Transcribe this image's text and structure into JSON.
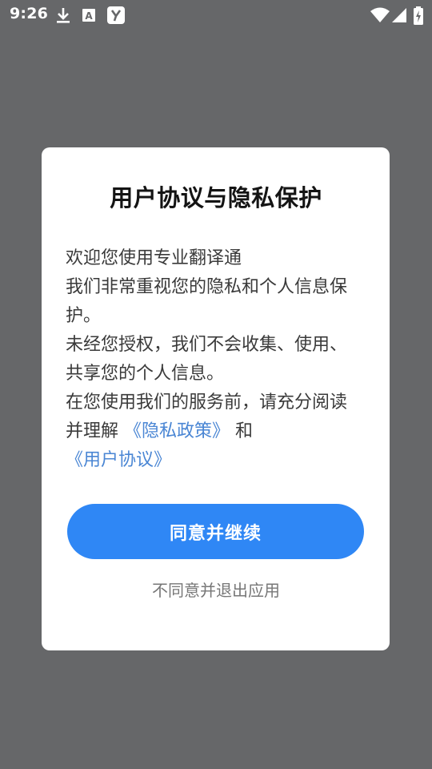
{
  "status_bar": {
    "time": "9:26",
    "icons": [
      "download-icon",
      "keyboard-a-icon",
      "app-y-icon",
      "wifi-icon",
      "signal-icon",
      "battery-charging-icon"
    ]
  },
  "dialog": {
    "title": "用户协议与隐私保护",
    "paragraphs": {
      "line1": "欢迎您使用专业翻译通",
      "line2": "我们非常重视您的隐私和个人信息保护。",
      "line3": "未经您授权，我们不会收集、使用、共享您的个人信息。",
      "line4_prefix": "在您使用我们的服务前，请充分阅读并理解",
      "privacy_link": "《隐私政策》",
      "and_text": "和",
      "user_link": "《用户协议》"
    },
    "agree_button": "同意并继续",
    "disagree_button": "不同意并退出应用"
  },
  "colors": {
    "accent": "#2f87f5",
    "link": "#4a86d4",
    "overlay": "#666769"
  }
}
